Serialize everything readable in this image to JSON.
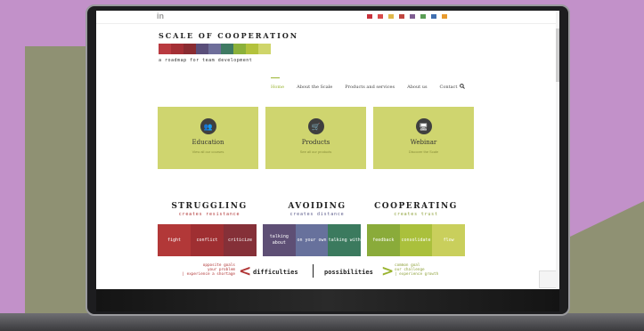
{
  "topbar": {
    "social": "in",
    "flags": [
      {
        "name": "flag-uk",
        "color": "#c8323c"
      },
      {
        "name": "flag-pl",
        "color": "#d94b4b"
      },
      {
        "name": "flag-de",
        "color": "#e0b84a"
      },
      {
        "name": "flag-nl",
        "color": "#c0463f"
      },
      {
        "name": "flag-hu",
        "color": "#7f5d92"
      },
      {
        "name": "flag-it",
        "color": "#5a9e55"
      },
      {
        "name": "flag-ro",
        "color": "#3f6fb0"
      },
      {
        "name": "flag-es",
        "color": "#e89b2e"
      }
    ]
  },
  "logo": {
    "title": "SCALE OF COOPERATION",
    "tagline": "a roadmap for team development",
    "bar_colors": [
      "#b93a40",
      "#a42f35",
      "#8a2b31",
      "#5a4e7a",
      "#6e6e9a",
      "#3f7a63",
      "#8bb13a",
      "#b3c23c",
      "#cfd56a"
    ]
  },
  "nav": {
    "items": [
      "Home",
      "About the Scale",
      "Products and services",
      "About us",
      "Contact"
    ],
    "active": "Home"
  },
  "cards": [
    {
      "icon": "people-icon",
      "glyph": "👥",
      "title": "Education",
      "subtitle": "View all our courses"
    },
    {
      "icon": "cart-icon",
      "glyph": "🛒",
      "title": "Products",
      "subtitle": "See all our products"
    },
    {
      "icon": "webinar-icon",
      "glyph": "🖥",
      "title": "Webinar",
      "subtitle": "Discover the Scale"
    }
  ],
  "columns": [
    {
      "heading": "STRUGGLING",
      "sub": "creates resistance",
      "sub_color": "#b03636"
    },
    {
      "heading": "AVOIDING",
      "sub": "creates distance",
      "sub_color": "#5a5a8a"
    },
    {
      "heading": "COOPERATING",
      "sub": "creates trust",
      "sub_color": "#8fa23b"
    }
  ],
  "strips": [
    {
      "cells": [
        {
          "label": "fight",
          "color": "#b23838"
        },
        {
          "label": "conflict",
          "color": "#9f2f32"
        },
        {
          "label": "criticize",
          "color": "#853038"
        }
      ]
    },
    {
      "cells": [
        {
          "label": "talking about",
          "color": "#5e4f75"
        },
        {
          "label": "on your own",
          "color": "#67719c"
        },
        {
          "label": "talking with",
          "color": "#3b7a5e"
        }
      ]
    },
    {
      "cells": [
        {
          "label": "feedback",
          "color": "#8aab3a"
        },
        {
          "label": "consolidate",
          "color": "#aac03c"
        },
        {
          "label": "flow",
          "color": "#c9cf5c"
        }
      ]
    }
  ],
  "bottom": {
    "left_lines": [
      "opposite goals",
      "your problem",
      "| experience a shortage"
    ],
    "difficulties": "difficulties",
    "possibilities": "possibilities",
    "right_lines": [
      "common goal",
      "our challenge",
      "| experience growth"
    ]
  }
}
